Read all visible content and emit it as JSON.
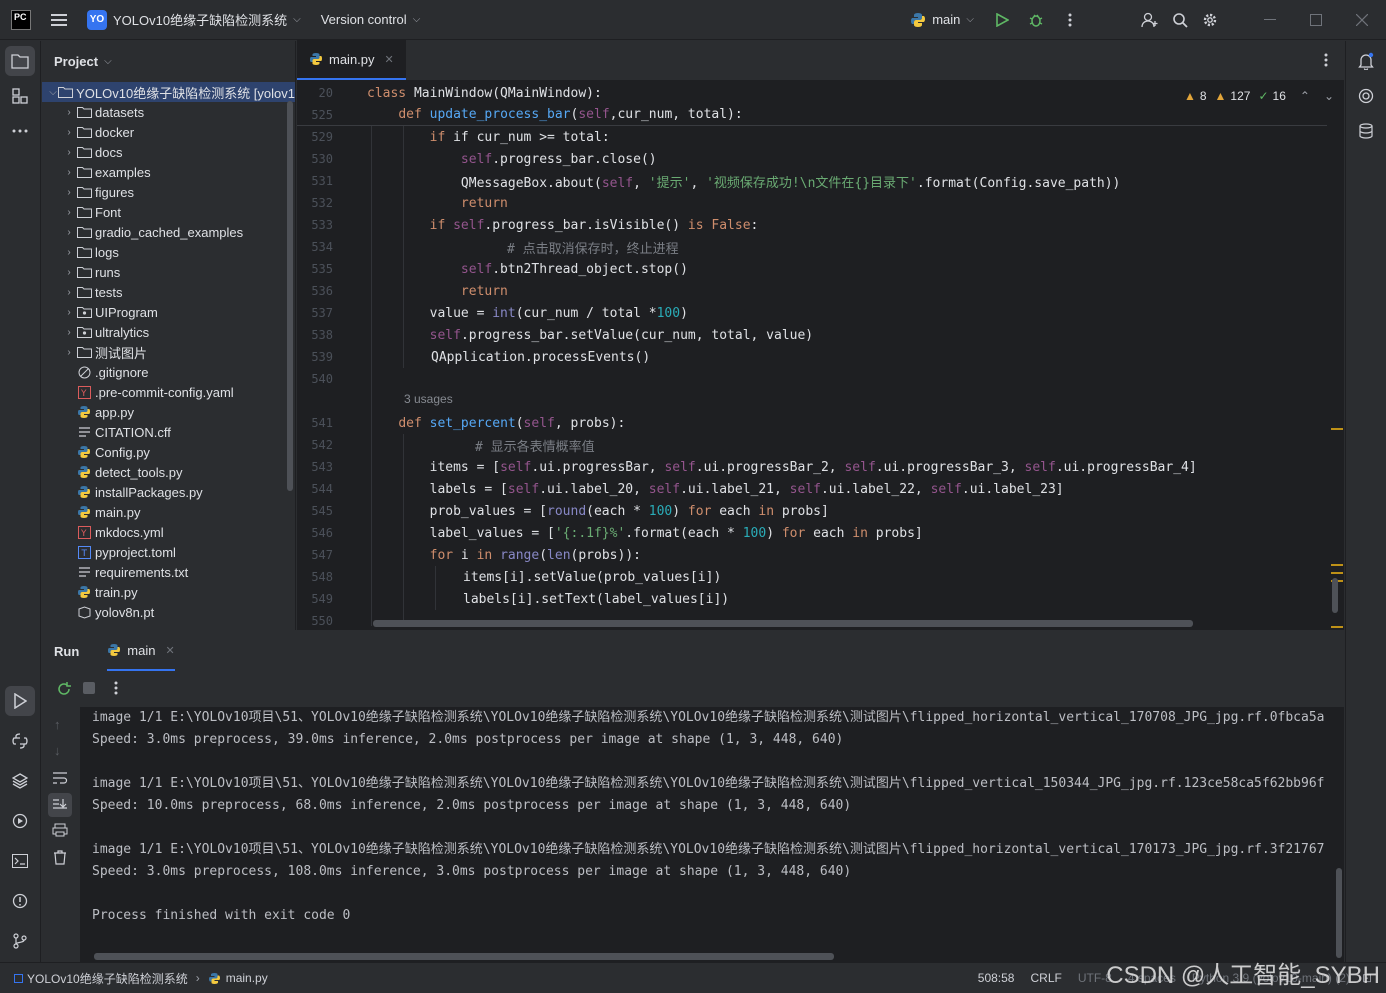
{
  "titlebar": {
    "app_logo": "PC",
    "project_badge": "YO",
    "project_name": "YOLOv10绝缘子缺陷检测系统",
    "version_control": "Version control",
    "run_config": "main"
  },
  "project_panel": {
    "title": "Project",
    "root": "YOLOv10绝缘子缺陷检测系统 [yolov1",
    "items": [
      {
        "label": "datasets",
        "type": "folder"
      },
      {
        "label": "docker",
        "type": "folder"
      },
      {
        "label": "docs",
        "type": "folder"
      },
      {
        "label": "examples",
        "type": "folder"
      },
      {
        "label": "figures",
        "type": "folder"
      },
      {
        "label": "Font",
        "type": "folder"
      },
      {
        "label": "gradio_cached_examples",
        "type": "folder"
      },
      {
        "label": "logs",
        "type": "folder"
      },
      {
        "label": "runs",
        "type": "folder"
      },
      {
        "label": "tests",
        "type": "folder"
      },
      {
        "label": "UIProgram",
        "type": "package"
      },
      {
        "label": "ultralytics",
        "type": "package"
      },
      {
        "label": "测试图片",
        "type": "folder"
      },
      {
        "label": ".gitignore",
        "type": "ignore"
      },
      {
        "label": ".pre-commit-config.yaml",
        "type": "yaml"
      },
      {
        "label": "app.py",
        "type": "python"
      },
      {
        "label": "CITATION.cff",
        "type": "text"
      },
      {
        "label": "Config.py",
        "type": "python"
      },
      {
        "label": "detect_tools.py",
        "type": "python"
      },
      {
        "label": "installPackages.py",
        "type": "python"
      },
      {
        "label": "main.py",
        "type": "python"
      },
      {
        "label": "mkdocs.yml",
        "type": "yaml"
      },
      {
        "label": "pyproject.toml",
        "type": "toml"
      },
      {
        "label": "requirements.txt",
        "type": "text"
      },
      {
        "label": "train.py",
        "type": "python"
      },
      {
        "label": "yolov8n.pt",
        "type": "binary"
      }
    ]
  },
  "editor": {
    "tab": "main.py",
    "inspections": {
      "warnings": "8",
      "weak_warnings": "127",
      "typos": "16"
    },
    "sticky": [
      {
        "ln": "20",
        "code": "class MainWindow(QMainWindow):"
      },
      {
        "ln": "525",
        "code": "    def update_process_bar(self,cur_num, total):"
      }
    ],
    "usages": "3 usages",
    "lines": [
      {
        "ln": "529"
      },
      {
        "ln": "530"
      },
      {
        "ln": "531"
      },
      {
        "ln": "532"
      },
      {
        "ln": "533"
      },
      {
        "ln": "534"
      },
      {
        "ln": "535"
      },
      {
        "ln": "536"
      },
      {
        "ln": "537"
      },
      {
        "ln": "538"
      },
      {
        "ln": "539"
      },
      {
        "ln": "540"
      },
      {
        "ln": "541"
      },
      {
        "ln": "542"
      },
      {
        "ln": "543"
      },
      {
        "ln": "544"
      },
      {
        "ln": "545"
      },
      {
        "ln": "546"
      },
      {
        "ln": "547"
      },
      {
        "ln": "548"
      },
      {
        "ln": "549"
      },
      {
        "ln": "550"
      }
    ],
    "code_text": {
      "l529": "if cur_num >= total:",
      "l530": "self.progress_bar.close()",
      "l531_a": "QMessageBox.about(",
      "l531_b": "'提示'",
      "l531_c": "'视频保存成功!\\n文件在{}目录下'",
      "l531_d": ".format(Config.save_path))",
      "l533": "self.progress_bar.isVisible() is False:",
      "l534": "# 点击取消保存时，终止进程",
      "l535": ".btn2Thread_object.stop()",
      "l537": "value = int(cur_num / total *100)",
      "l538": ".progress_bar.setValue(cur_num, total, value)",
      "l539": "QApplication.processEvents()",
      "l541": "def set_percent(self, probs):",
      "l542": "# 显示各表情概率值",
      "l543": "items = [self.ui.progressBar, self.ui.progressBar_2, self.ui.progressBar_3, self.ui.progressBar_4]",
      "l544": "labels = [self.ui.label_20, self.ui.label_21, self.ui.label_22, self.ui.label_23]",
      "l545": "prob_values = [round(each * 100) for each in probs]",
      "l546": "label_values = ['{:.1f}%'.format(each * 100) for each in probs]",
      "l547": "for i in range(len(probs)):",
      "l548": "items[i].setValue(prob_values[i])",
      "l549": "labels[i].setText(label_values[i])"
    }
  },
  "run_panel": {
    "title": "Run",
    "tab": "main",
    "output": [
      "image 1/1 E:\\YOLOv10项目\\51、YOLOv10绝缘子缺陷检测系统\\YOLOv10绝缘子缺陷检测系统\\YOLOv10绝缘子缺陷检测系统\\测试图片\\flipped_horizontal_vertical_170708_JPG_jpg.rf.0fbca5a",
      "Speed: 3.0ms preprocess, 39.0ms inference, 2.0ms postprocess per image at shape (1, 3, 448, 640)",
      "",
      "image 1/1 E:\\YOLOv10项目\\51、YOLOv10绝缘子缺陷检测系统\\YOLOv10绝缘子缺陷检测系统\\YOLOv10绝缘子缺陷检测系统\\测试图片\\flipped_vertical_150344_JPG_jpg.rf.123ce58ca5f62bb96f",
      "Speed: 10.0ms preprocess, 68.0ms inference, 2.0ms postprocess per image at shape (1, 3, 448, 640)",
      "",
      "image 1/1 E:\\YOLOv10项目\\51、YOLOv10绝缘子缺陷检测系统\\YOLOv10绝缘子缺陷检测系统\\YOLOv10绝缘子缺陷检测系统\\测试图片\\flipped_horizontal_vertical_170173_JPG_jpg.rf.3f21767",
      "Speed: 3.0ms preprocess, 108.0ms inference, 3.0ms postprocess per image at shape (1, 3, 448, 640)",
      "",
      "Process finished with exit code 0"
    ]
  },
  "statusbar": {
    "breadcrumb_project": "YOLOv10绝缘子缺陷检测系统",
    "breadcrumb_file": "main.py",
    "position": "508:58",
    "line_sep": "CRLF",
    "encoding": "UTF-8",
    "indent": "4 spaces",
    "interpreter": "Python 3.9 (yolov10-main) (2)",
    "watermark": "CSDN @人工智能_SYBH"
  },
  "colors": {
    "accent": "#3574f0",
    "bg": "#1e1f22",
    "panel": "#2b2d30",
    "keyword": "#cf8e6d",
    "self": "#94558d",
    "function": "#56a8f5",
    "string": "#6aab73",
    "comment": "#7a7e85",
    "number": "#2aacb8",
    "warning": "#be9117"
  }
}
